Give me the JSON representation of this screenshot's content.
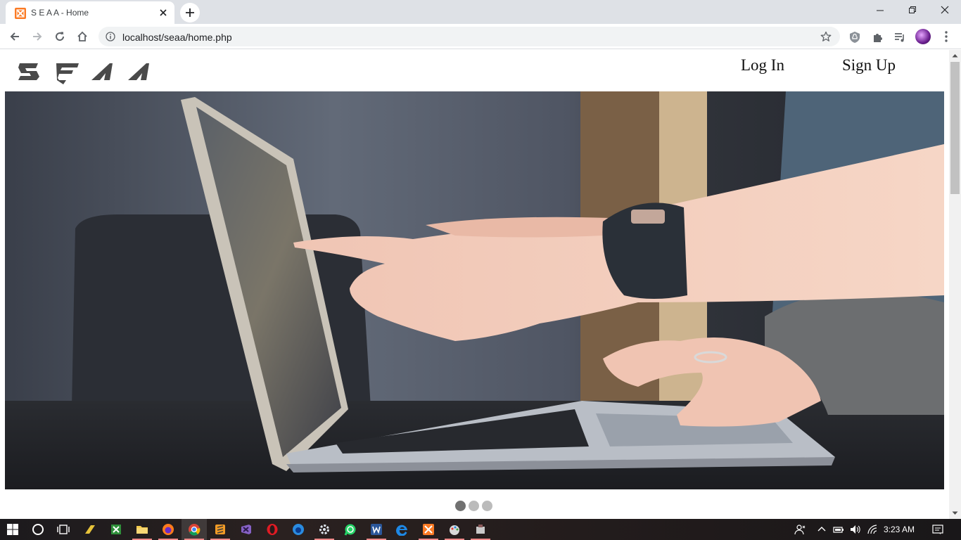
{
  "browser": {
    "tab_title": "S E A A - Home",
    "url": "localhost/seaa/home.php"
  },
  "site": {
    "nav": {
      "login_label": "Log In",
      "signup_label": "Sign Up"
    },
    "carousel": {
      "slide_count": 3,
      "active_slide": 1
    }
  },
  "taskbar": {
    "time": "3:23 AM"
  },
  "colors": {
    "tab_strip": "#dee1e6",
    "omnibox": "#f1f3f4",
    "xampp_orange": "#fb7a24",
    "dot_active": "#717171",
    "dot_inactive": "#bbbbbb"
  },
  "icons": [
    "xampp-favicon",
    "close-icon",
    "plus-icon",
    "back-arrow-icon",
    "forward-arrow-icon",
    "reload-icon",
    "home-icon",
    "info-icon",
    "star-icon",
    "shield-extension-icon",
    "puzzle-icon",
    "media-icon",
    "kebab-menu-icon",
    "windows-start-icon",
    "cortana-icon",
    "task-view-icon"
  ]
}
